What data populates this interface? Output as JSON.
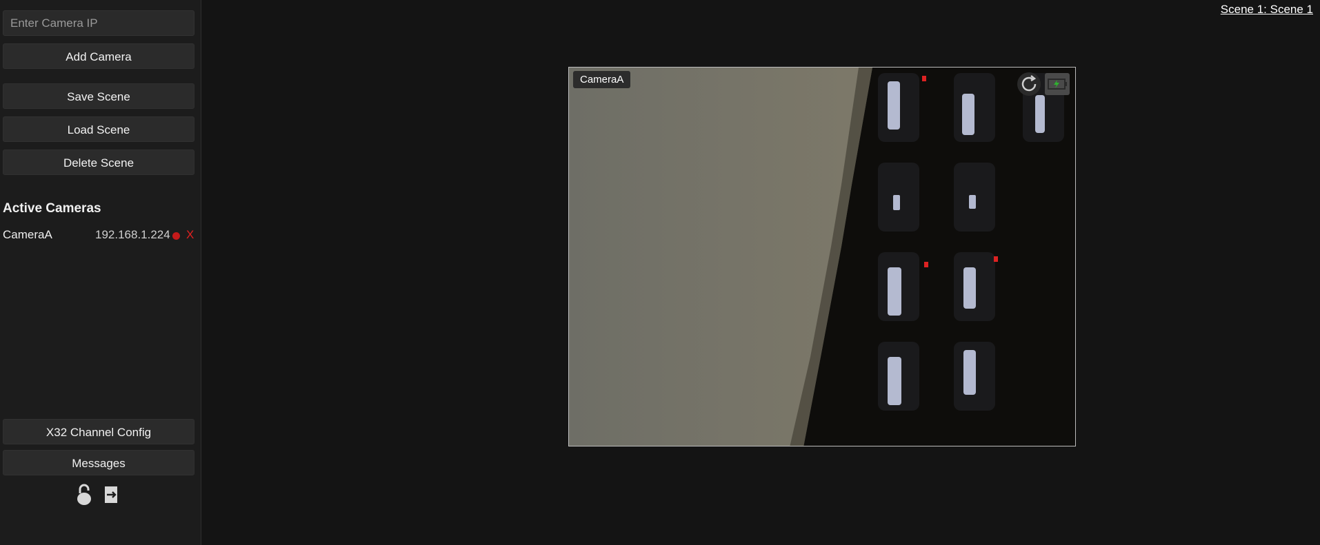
{
  "sidebar": {
    "ip_placeholder": "Enter Camera IP",
    "add_camera": "Add Camera",
    "save_scene": "Save Scene",
    "load_scene": "Load Scene",
    "delete_scene": "Delete Scene",
    "active_cameras_title": "Active Cameras",
    "cameras": [
      {
        "name": "CameraA",
        "ip": "192.168.1.224",
        "status_color": "#c41a1a",
        "remove_label": "X"
      }
    ],
    "x32_config": "X32 Channel Config",
    "messages": "Messages",
    "icons": [
      "unlock-icon",
      "logout-icon"
    ]
  },
  "header": {
    "scene_label": "Scene 1: Scene 1"
  },
  "feed": {
    "camera_label": "CameraA",
    "icons": [
      "refresh-icon",
      "battery-icon"
    ],
    "battery_color": "#2fb32f"
  }
}
